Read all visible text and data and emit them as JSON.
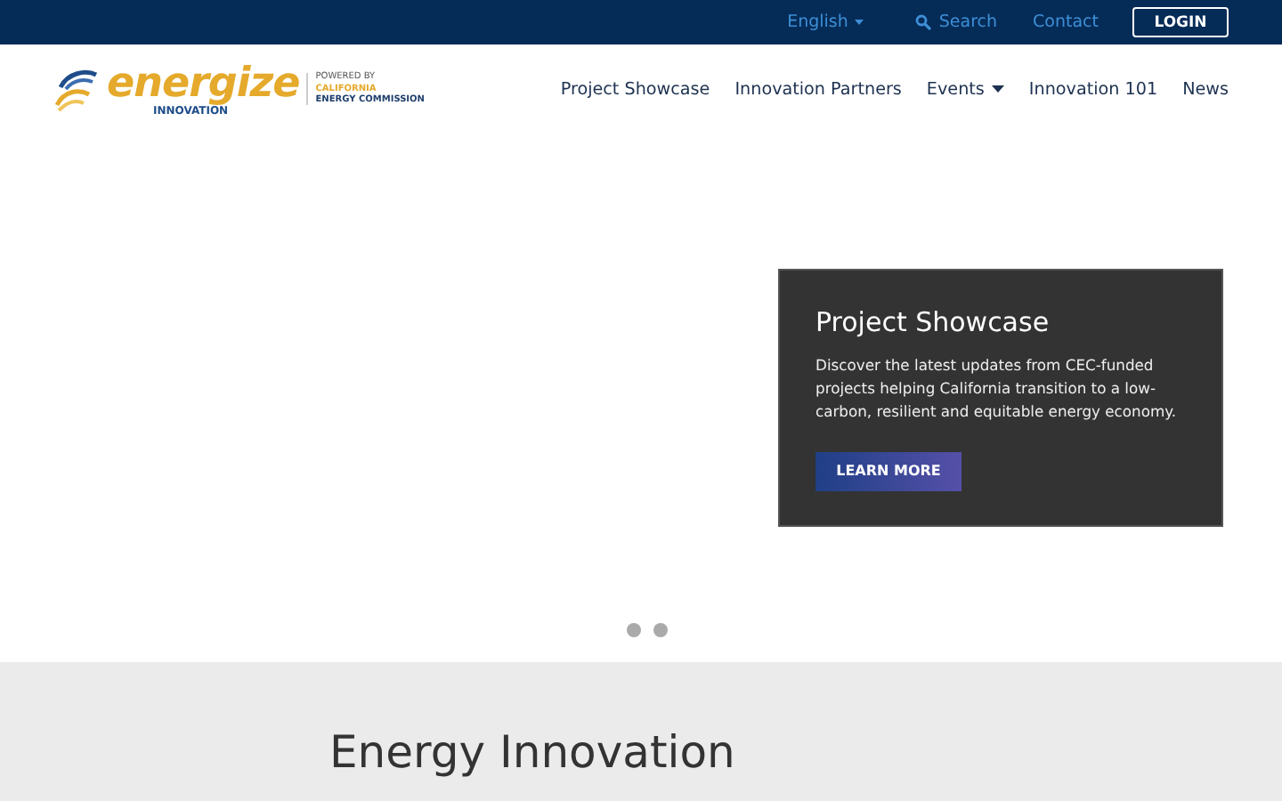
{
  "top_bar": {
    "language": "English",
    "search": "Search",
    "contact": "Contact",
    "login": "LOGIN"
  },
  "logo": {
    "word": "energize",
    "sub": "INNOVATION",
    "powered": "POWERED BY",
    "org_line1": "CALIFORNIA",
    "org_line2": "ENERGY COMMISSION"
  },
  "nav": [
    {
      "label": "Project Showcase",
      "dropdown": false
    },
    {
      "label": "Innovation Partners",
      "dropdown": false
    },
    {
      "label": "Events",
      "dropdown": true
    },
    {
      "label": "Innovation 101",
      "dropdown": false
    },
    {
      "label": "News",
      "dropdown": false
    }
  ],
  "hero_card": {
    "title": "Project Showcase",
    "text": "Discover the latest updates from CEC-funded projects helping California transition to a low-carbon, resilient and equitable energy economy.",
    "button": "LEARN MORE"
  },
  "section": {
    "heading": "Energy Innovation"
  }
}
